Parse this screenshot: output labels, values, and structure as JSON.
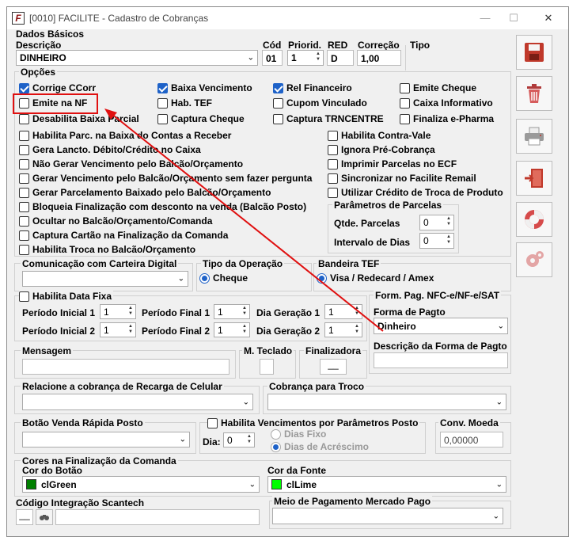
{
  "window": {
    "title": "[0010] FACILITE - Cadastro de Cobranças"
  },
  "dados_basicos": {
    "title": "Dados Básicos",
    "descricao_label": "Descrição",
    "descricao_value": "DINHEIRO",
    "cod_label": "Cód",
    "cod_value": "01",
    "prioridade_label": "Priorid.",
    "prioridade_value": "1",
    "red_label": "RED",
    "red_value": "D",
    "correcao_label": "Correção",
    "correcao_value": "1,00",
    "tipo_label": "Tipo"
  },
  "opcoes": {
    "title": "Opções",
    "corrige_ccorr": "Corrige CCorr",
    "baixa_vencimento": "Baixa Vencimento",
    "rel_financeiro": "Rel Financeiro",
    "emite_cheque": "Emite Cheque",
    "emite_nf": "Emite na NF",
    "hab_tef": "Hab. TEF",
    "cupom_vinculado": "Cupom Vinculado",
    "caixa_informativo": "Caixa Informativo",
    "desabilita_baixa_parcial": "Desabilita Baixa Parcial",
    "captura_cheque": "Captura Cheque",
    "captura_trncentre": "Captura TRNCENTRE",
    "finaliza_epharma": "Finaliza e-Pharma",
    "left_list": [
      "Habilita Parc. na Baixa do Contas a Receber",
      "Gera Lancto. Débito/Crédito no Caixa",
      "Não Gerar Vencimento pelo Balcão/Orçamento",
      "Gerar Vencimento pelo Balcão/Orçamento sem fazer pergunta",
      "Gerar Parcelamento Baixado pelo Balcão/Orçamento",
      "Bloqueia Finalização com desconto na venda (Balcão Posto)",
      "Ocultar no Balcão/Orçamento/Comanda",
      "Captura Cartão na Finalização da Comanda",
      "Habilita Troca no Balcão/Orçamento"
    ],
    "right_list": [
      "Habilita Contra-Vale",
      "Ignora Pré-Cobrança",
      "Imprimir Parcelas no ECF",
      "Sincronizar no Facilite Remail",
      "Utilizar Crédito de Troca de Produto"
    ]
  },
  "parametros_parcelas": {
    "title": "Parâmetros de Parcelas",
    "qtde_label": "Qtde. Parcelas",
    "qtde_value": "0",
    "intervalo_label": "Intervalo de Dias",
    "intervalo_value": "0"
  },
  "comunicacao": {
    "title": "Comunicação com Carteira Digital"
  },
  "tipo_operacao": {
    "title": "Tipo da Operação",
    "option": "Cheque"
  },
  "bandeira_tef": {
    "title": "Bandeira TEF",
    "option": "Visa / Redecard / Amex"
  },
  "data_fixa": {
    "habilita": "Habilita Data Fixa",
    "periodo_inicial_1": "Período Inicial 1",
    "pi1": "1",
    "periodo_final_1": "Período Final 1",
    "pf1": "1",
    "dia_geracao_1": "Dia Geração 1",
    "dg1": "1",
    "periodo_inicial_2": "Período Inicial 2",
    "pi2": "1",
    "periodo_final_2": "Período Final 2",
    "pf2": "1",
    "dia_geracao_2": "Dia Geração 2",
    "dg2": "1"
  },
  "form_pag": {
    "title": "Form. Pag. NFC-e/NF-e/SAT",
    "forma_label": "Forma de Pagto",
    "forma_value": "Dinheiro",
    "descricao_label": "Descrição da Forma de Pagto"
  },
  "mensagem": {
    "label": "Mensagem"
  },
  "m_teclado": {
    "label": "M. Teclado"
  },
  "finalizadora": {
    "label": "Finalizadora",
    "value": "__"
  },
  "recarga": {
    "title": "Relacione a cobrança de Recarga de Celular"
  },
  "troco": {
    "title": "Cobrança para Troco"
  },
  "venda_rapida": {
    "title": "Botão Venda Rápida Posto"
  },
  "vencimentos": {
    "habilita": "Habilita Vencimentos por Parâmetros Posto",
    "dia_label": "Dia:",
    "dia_value": "0",
    "dias_fixo": "Dias Fixo",
    "dias_acrescimo": "Dias de Acréscimo"
  },
  "conv_moeda": {
    "title": "Conv. Moeda",
    "value": "0,00000"
  },
  "cores": {
    "title": "Cores na Finalização da Comanda",
    "cor_botao_label": "Cor do Botão",
    "cor_botao_value": "clGreen",
    "cor_botao_hex": "#008000",
    "cor_fonte_label": "Cor da Fonte",
    "cor_fonte_value": "clLime",
    "cor_fonte_hex": "#00ff00"
  },
  "scantech": {
    "label": "Código Integração Scantech",
    "value": "__"
  },
  "mercado_pago": {
    "label": "Meio de Pagamento Mercado Pago"
  },
  "side_toolbar": [
    "save-icon",
    "trash-icon",
    "print-icon",
    "exit-icon",
    "lifebuoy-icon",
    "settings-icon"
  ],
  "annotation": {
    "highlight_color": "#e01010"
  }
}
